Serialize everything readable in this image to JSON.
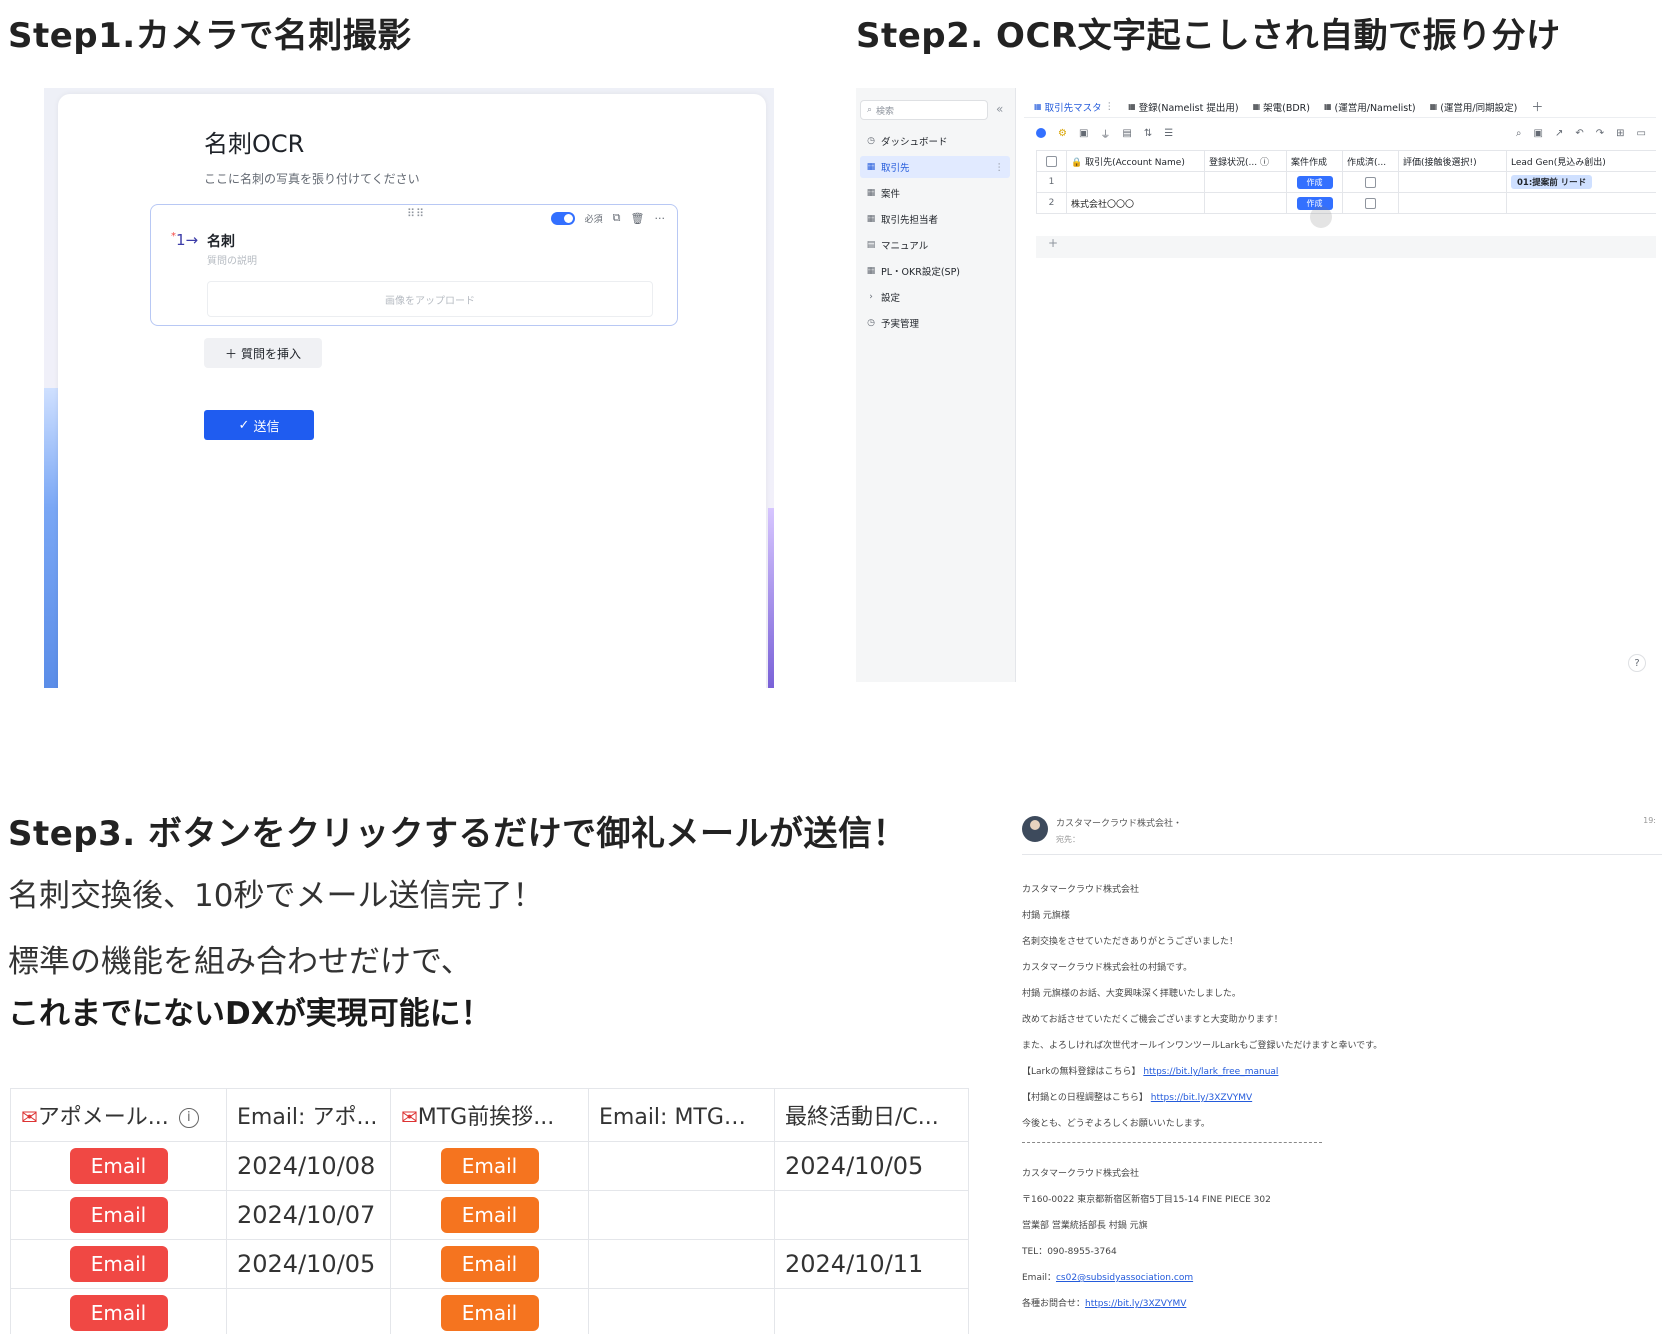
{
  "titles": {
    "step1": "Step1.カメラで名刺撮影",
    "step2": "Step2. OCR文字起こしされ自動で振り分け",
    "step3": "Step3. ボタンをクリックするだけで御礼メールが送信！"
  },
  "step1_form": {
    "title": "名刺OCR",
    "subtitle": "ここに名刺の写真を張り付けてください",
    "question_number": "1→",
    "question_label": "名刺",
    "question_desc": "質問の説明",
    "required_label": "必須",
    "upload_placeholder": "画像をアップロード",
    "insert_button": "質問を挿入",
    "submit_button": "送信"
  },
  "step2_app": {
    "search_placeholder": "検索",
    "sidebar": [
      {
        "label": "ダッシュボード",
        "icon": "dashboard-icon",
        "active": false
      },
      {
        "label": "取引先",
        "icon": "table-icon",
        "active": true
      },
      {
        "label": "案件",
        "icon": "table-icon",
        "active": false
      },
      {
        "label": "取引先担当者",
        "icon": "table-icon",
        "active": false
      },
      {
        "label": "マニュアル",
        "icon": "doc-icon",
        "active": false
      },
      {
        "label": "PL・OKR設定(SP)",
        "icon": "table-icon",
        "active": false
      },
      {
        "label": "設定",
        "icon": "caret-icon",
        "active": false
      },
      {
        "label": "予実管理",
        "icon": "dashboard-icon",
        "active": false
      }
    ],
    "tabs": [
      "取引先マスタ",
      "登録(Namelist 提出用)",
      "架電(BDR)",
      "(運営用/Namelist)",
      "(運営用/同期設定)"
    ],
    "columns": [
      "取引先(Account Name)",
      "登録状況(...",
      "案件作成",
      "作成済(...",
      "評価(接触後選択!)",
      "Lead Gen(見込み創出)"
    ],
    "rows": [
      {
        "num": "1",
        "account": "",
        "create": "作成",
        "lead": "01:提案前 リード"
      },
      {
        "num": "2",
        "account": "株式会社〇〇〇",
        "create": "作成",
        "lead": ""
      }
    ],
    "add_row": "+",
    "help": "?"
  },
  "step3_text": {
    "line1": "名刺交換後、10秒でメール送信完了！",
    "line2": "標準の機能を組み合わせだけで、",
    "line3": "これまでにないDXが実現可能に！"
  },
  "step3_table": {
    "headers": [
      "アポメール...",
      "Email: アポ...",
      "MTG前挨拶...",
      "Email: MTG前...",
      "最終活動日/C..."
    ],
    "rows": [
      {
        "btn1": "Email",
        "date1": "2024/10/08",
        "btn2": "Email",
        "mtg": "",
        "last": "2024/10/05"
      },
      {
        "btn1": "Email",
        "date1": "2024/10/07",
        "btn2": "Email",
        "mtg": "",
        "last": ""
      },
      {
        "btn1": "Email",
        "date1": "2024/10/05",
        "btn2": "Email",
        "mtg": "",
        "last": "2024/10/11"
      },
      {
        "btn1": "Email",
        "date1": "",
        "btn2": "Email",
        "mtg": "",
        "last": ""
      }
    ]
  },
  "step3_mail": {
    "from": "カスタマークラウド株式会社・",
    "to": "宛先：",
    "time": "19:",
    "lines": [
      "カスタマークラウド株式会社",
      "村鍋 元旗様",
      "名刺交換をさせていただきありがとうございました！",
      "カスタマークラウド株式会社の村鍋です。",
      "村鍋 元旗様のお話、大変興味深く拝聴いたしました。",
      "改めてお話させていただくご機会ございますと大変助かります！",
      "また、よろしければ次世代オールインワンツールLarkもご登録いただけますと幸いです。"
    ],
    "lark_text": "【Larkの無料登録はこちら】",
    "lark_link": "https://bit.ly/lark_free_manual",
    "meeting_text": "【村鍋との日程調整はこちら】",
    "meeting_link": "https://bit.ly/3XZVYMV",
    "closing": "今後とも、どうぞよろしくお願いいたします。",
    "signature": [
      "カスタマークラウド株式会社",
      "〒160-0022 東京都新宿区新宿5丁目15-14 FINE PIECE 302",
      "営業部 営業統括部長 村鍋 元旗",
      "TEL：090-8955-3764"
    ],
    "email_label": "Email：",
    "email_value": "cs02@subsidyassociation.com",
    "inquiry_label": "各種お問合せ：",
    "inquiry_link": "https://bit.ly/3XZVYMV"
  },
  "colors": {
    "email_red": "#f04844",
    "email_orange": "#f5741f",
    "submit_blue": "#1f5cf0",
    "active_blue": "#245bdb"
  }
}
